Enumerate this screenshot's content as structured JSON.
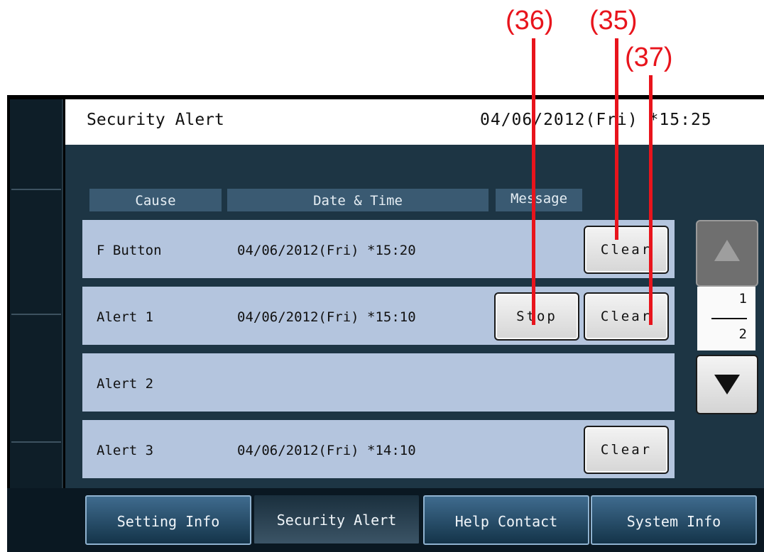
{
  "header": {
    "title": "Security Alert",
    "datetime": "04/06/2012(Fri)  *15:25"
  },
  "columns": {
    "cause": "Cause",
    "datetime": "Date & Time",
    "message": "Message"
  },
  "rows": [
    {
      "cause": "F Button",
      "datetime": "04/06/2012(Fri) *15:20",
      "stop_label": "",
      "clear_label": "Clear"
    },
    {
      "cause": "Alert 1",
      "datetime": "04/06/2012(Fri) *15:10",
      "stop_label": "Stop",
      "clear_label": "Clear"
    },
    {
      "cause": "Alert 2",
      "datetime": "",
      "stop_label": "",
      "clear_label": ""
    },
    {
      "cause": "Alert 3",
      "datetime": "04/06/2012(Fri) *14:10",
      "stop_label": "",
      "clear_label": "Clear"
    }
  ],
  "pager": {
    "current": "1",
    "total": "2",
    "up_icon": "triangle-up-icon",
    "down_icon": "triangle-down-icon"
  },
  "tabs": [
    {
      "label": "Setting Info",
      "active": false
    },
    {
      "label": "Security Alert",
      "active": true
    },
    {
      "label": "Help Contact",
      "active": false
    },
    {
      "label": "System Info",
      "active": false
    }
  ],
  "annotations": {
    "a36": "(36)",
    "a35": "(35)",
    "a37": "(37)"
  },
  "colors": {
    "annotation": "#e8141c",
    "row": "#b4c5de",
    "screen": "#1d3544"
  }
}
